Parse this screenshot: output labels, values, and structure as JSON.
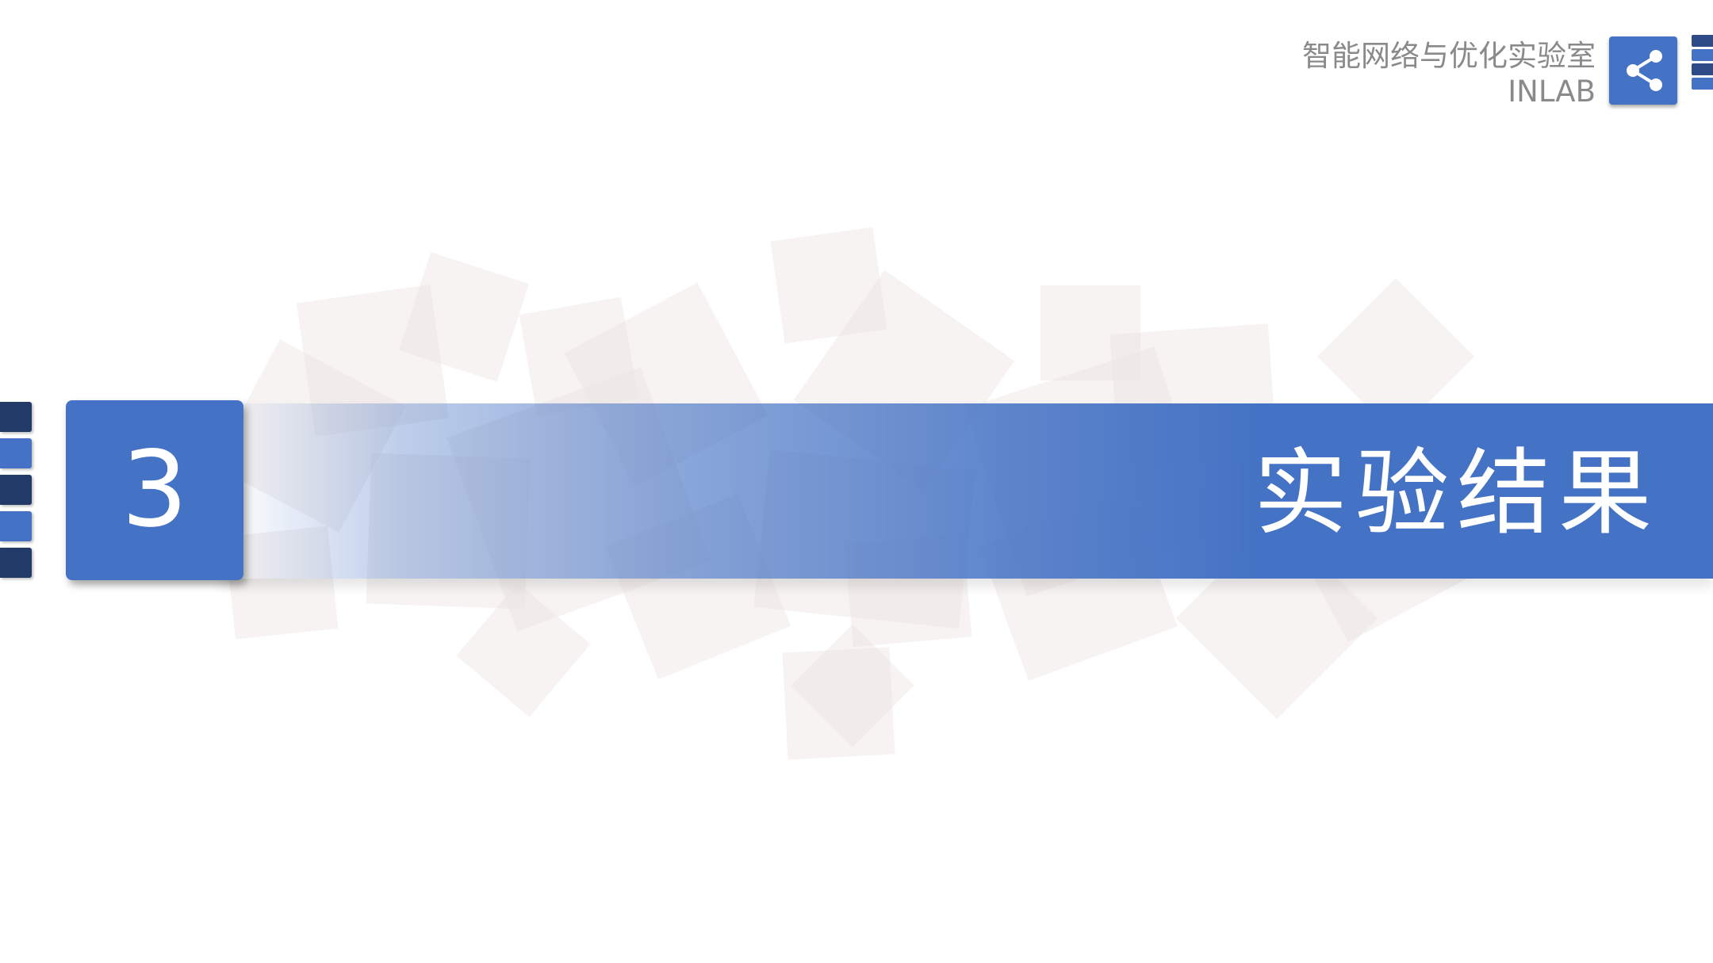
{
  "header": {
    "lab_name": "智能网络与优化实验室",
    "lab_abbr": "INLAB",
    "icon": "share-icon"
  },
  "section": {
    "number": "3",
    "title": "实验结果"
  },
  "colors": {
    "accent": "#4472c4",
    "accent_dark": "#2e4b87",
    "navy": "#223a68",
    "header_text": "#8a8a8a",
    "background": "#ffffff"
  }
}
